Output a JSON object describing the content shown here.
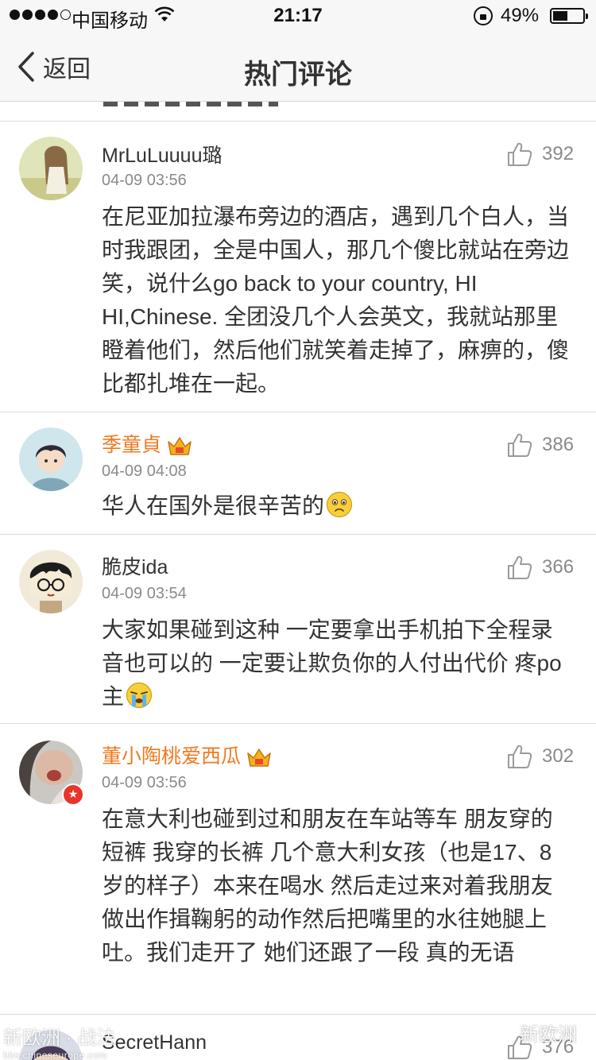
{
  "status_bar": {
    "carrier": "中国移动",
    "time": "21:17",
    "battery": "49%",
    "battery_level": 0.49
  },
  "nav": {
    "back_label": "返回",
    "title": "热门评论"
  },
  "comments": [
    {
      "user": "MrLuLuuuu璐",
      "time": "04-09 03:56",
      "likes": "392",
      "vip": false,
      "text": "在尼亚加拉瀑布旁边的酒店，遇到几个白人，当时我跟团，全是中国人，那几个傻比就站在旁边笑，说什么go back to your country, HI HI,Chinese. 全团没几个人会英文，我就站那里瞪着他们，然后他们就笑着走掉了，麻痹的，傻比都扎堆在一起。"
    },
    {
      "user": "季童貞",
      "time": "04-09 04:08",
      "likes": "386",
      "vip": true,
      "text": "华人在国外是很辛苦的",
      "emoji": "sad-face-emoji"
    },
    {
      "user": "脆皮ida",
      "time": "04-09 03:54",
      "likes": "366",
      "vip": false,
      "text": "大家如果碰到这种 一定要拿出手机拍下全程录音也可以的 一定要让欺负你的人付出代价 疼po主",
      "emoji": "crying-face-emoji"
    },
    {
      "user": "董小陶桃爱西瓜",
      "time": "04-09 03:56",
      "likes": "302",
      "vip": true,
      "text": "在意大利也碰到过和朋友在车站等车 朋友穿的短裤 我穿的长裤 几个意大利女孩（也是17、8岁的样子）本来在喝水 然后走过来对着我朋友做出作揖鞠躬的动作然后把嘴里的水往她腿上吐。我们走开了 她们还跟了一段 真的无语"
    },
    {
      "user": "SecretHann",
      "likes": "376"
    }
  ],
  "watermark": {
    "left_title": "新欧洲 · 战法",
    "left_url": "bbs.chineseurope.com",
    "right_label": "新欧洲"
  }
}
